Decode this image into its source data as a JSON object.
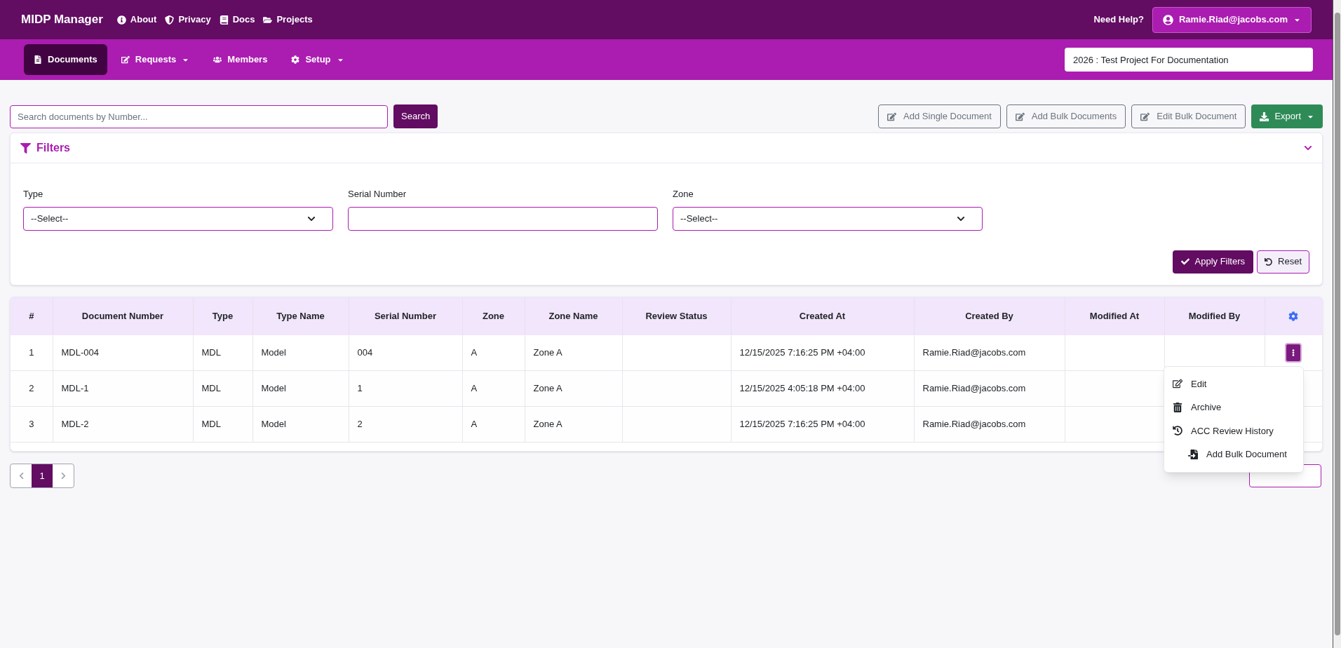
{
  "brand": "MIDP Manager",
  "top_links": [
    {
      "label": "About"
    },
    {
      "label": "Privacy"
    },
    {
      "label": "Docs"
    },
    {
      "label": "Projects"
    }
  ],
  "help_label": "Need Help?",
  "user_menu": {
    "label": "Ramie.Riad@jacobs.com",
    "dropdown": true
  },
  "nav_tabs": [
    {
      "label": "Documents",
      "selected": true,
      "dropdown": false
    },
    {
      "label": "Requests",
      "selected": false,
      "dropdown": true
    },
    {
      "label": "Members",
      "selected": false,
      "dropdown": false
    },
    {
      "label": "Setup",
      "selected": false,
      "dropdown": true
    }
  ],
  "project_field": {
    "value": "2026 : Test Project For Documentation"
  },
  "search": {
    "placeholder": "Search documents by Number...",
    "button": "Search"
  },
  "actions": [
    {
      "label": "Add Single Document",
      "kind": "outline"
    },
    {
      "label": "Add Bulk Documents",
      "kind": "outline"
    },
    {
      "label": "Edit Bulk Document",
      "kind": "outline"
    },
    {
      "label": "Export",
      "kind": "export"
    }
  ],
  "filters": {
    "title": "Filters",
    "expanded": true,
    "fields": [
      {
        "label": "Type",
        "kind": "select",
        "value": "--Select--"
      },
      {
        "label": "Serial Number",
        "kind": "text"
      },
      {
        "label": "Zone",
        "kind": "select",
        "value": "--Select--"
      }
    ],
    "apply": "Apply Filters",
    "reset": "Reset"
  },
  "table": {
    "columns": [
      "#",
      "Document Number",
      "Type",
      "Type Name",
      "Serial Number",
      "Zone",
      "Zone Name",
      "Review Status",
      "Created At",
      "Created By",
      "Modified At",
      "Modified By"
    ],
    "rows": [
      {
        "cells": [
          "1",
          "MDL-004",
          "MDL",
          "Model",
          "004",
          "A",
          "Zone A",
          null,
          "12/15/2025 7:16:25 PM +04:00",
          "Ramie.Riad@jacobs.com",
          null,
          null
        ],
        "menu_open": true
      },
      {
        "cells": [
          "2",
          "MDL-1",
          "MDL",
          "Model",
          "1",
          "A",
          "Zone A",
          null,
          "12/15/2025 4:05:18 PM +04:00",
          "Ramie.Riad@jacobs.com",
          null,
          null
        ],
        "menu_open": false
      },
      {
        "cells": [
          "3",
          "MDL-2",
          "MDL",
          "Model",
          "2",
          "A",
          "Zone A",
          null,
          "12/15/2025 7:16:25 PM +04:00",
          "Ramie.Riad@jacobs.com",
          null,
          null
        ],
        "menu_open": false
      }
    ]
  },
  "row_menu": [
    "Edit",
    "Archive",
    "ACC Review History",
    "Add Bulk Document"
  ],
  "pagination": {
    "pages": [
      {
        "label": "1",
        "selected": true
      }
    ]
  }
}
